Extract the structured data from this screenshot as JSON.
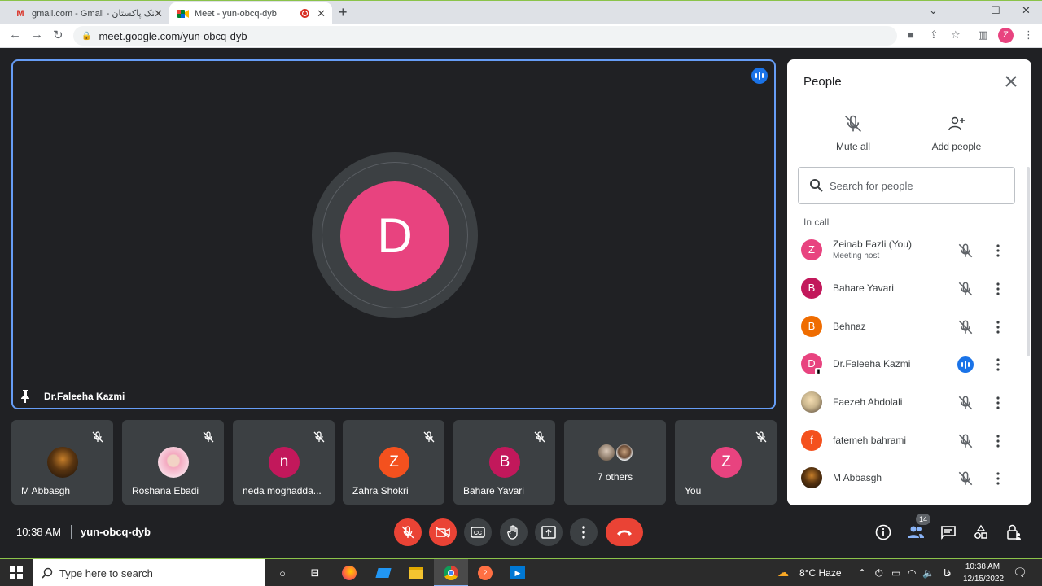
{
  "browser": {
    "tabs": [
      {
        "title": "gmail.com - Gmail - لینک پاکستان",
        "favicon": "M"
      },
      {
        "title": "Meet - yun-obcq-dyb",
        "favicon": "meet"
      }
    ],
    "url": "meet.google.com/yun-obcq-dyb",
    "profile_initial": "Z"
  },
  "meet": {
    "main_speaker": {
      "initial": "D",
      "name": "Dr.Faleeha Kazmi"
    },
    "tiles": [
      {
        "name": "M Abbasgh",
        "type": "photo"
      },
      {
        "name": "Roshana Ebadi",
        "type": "photo"
      },
      {
        "name": "neda moghadda...",
        "initial": "n",
        "color": "#c2185b"
      },
      {
        "name": "Zahra Shokri",
        "initial": "Z",
        "color": "#f4511e"
      },
      {
        "name": "Bahare Yavari",
        "initial": "B",
        "color": "#c2185b"
      },
      {
        "name": "",
        "others_label": "7 others"
      },
      {
        "name": "You",
        "initial": "Z",
        "color": "#e8437f"
      }
    ],
    "time": "10:38 AM",
    "meeting_code": "yun-obcq-dyb",
    "participant_count": "14"
  },
  "people_panel": {
    "title": "People",
    "mute_all": "Mute all",
    "add_people": "Add people",
    "search_placeholder": "Search for people",
    "section": "In call",
    "people": [
      {
        "name": "Zeinab Fazli (You)",
        "sub": "Meeting host",
        "initial": "Z",
        "color": "#e8437f",
        "state": "muted"
      },
      {
        "name": "Bahare Yavari",
        "initial": "B",
        "color": "#c2185b",
        "state": "muted"
      },
      {
        "name": "Behnaz",
        "initial": "B",
        "color": "#ef6c00",
        "state": "muted"
      },
      {
        "name": "Dr.Faleeha Kazmi",
        "initial": "D",
        "color": "#e8437f",
        "state": "speaking"
      },
      {
        "name": "Faezeh Abdolali",
        "initial": "",
        "color": "#d7ccc8",
        "state": "muted"
      },
      {
        "name": "fatemeh bahrami",
        "initial": "f",
        "color": "#f4511e",
        "state": "muted"
      },
      {
        "name": "M Abbasgh",
        "initial": "",
        "color": "#4e342e",
        "state": "muted"
      }
    ]
  },
  "taskbar": {
    "search_placeholder": "Type here to search",
    "weather": "8°C  Haze",
    "lang": "فا",
    "time": "10:38 AM",
    "date": "12/15/2022",
    "chrome_badge": "2"
  }
}
